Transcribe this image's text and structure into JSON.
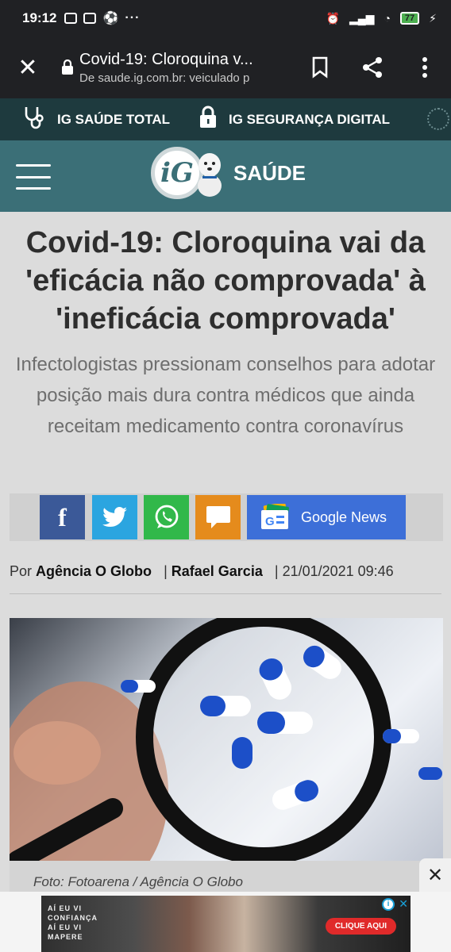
{
  "status_bar": {
    "time": "19:12",
    "battery": "77"
  },
  "browser": {
    "page_title": "Covid-19: Cloroquina v...",
    "url_line": "De saude.ig.com.br: veiculado p"
  },
  "ig_nav": {
    "items": [
      {
        "label": "IG SAÚDE TOTAL",
        "icon": "stethoscope-icon"
      },
      {
        "label": "IG SEGURANÇA DIGITAL",
        "icon": "padlock-icon"
      }
    ]
  },
  "header": {
    "logo_text": "iG",
    "section": "SAÚDE"
  },
  "article": {
    "headline": "Covid-19: Cloroquina vai da 'eficácia não comprovada' à 'ineficácia comprovada'",
    "subtitle": "Infectologistas pressionam conselhos para adotar posição mais dura contra médicos que ainda receitam medicamento contra coronavírus",
    "byline_prefix": "Por",
    "source": "Agência O Globo",
    "author": "Rafael Garcia",
    "date": "21/01/2021 09:46",
    "photo_caption": "Foto: Fotoarena / Agência O Globo"
  },
  "share": {
    "google_news_label": "Google News"
  },
  "ad": {
    "text_lines": [
      "AÍ EU VI",
      "CONFIANÇA",
      "AÍ EU VI",
      "MAPERE"
    ],
    "cta": "CLIQUE AQUI"
  },
  "colors": {
    "nav_bg": "#1e3a3e",
    "header_bg": "#3b6f77",
    "facebook": "#3b5998",
    "twitter": "#2ba5e0",
    "whatsapp": "#31b84a",
    "comment": "#e58b1c",
    "google_news": "#3d6fd8"
  }
}
